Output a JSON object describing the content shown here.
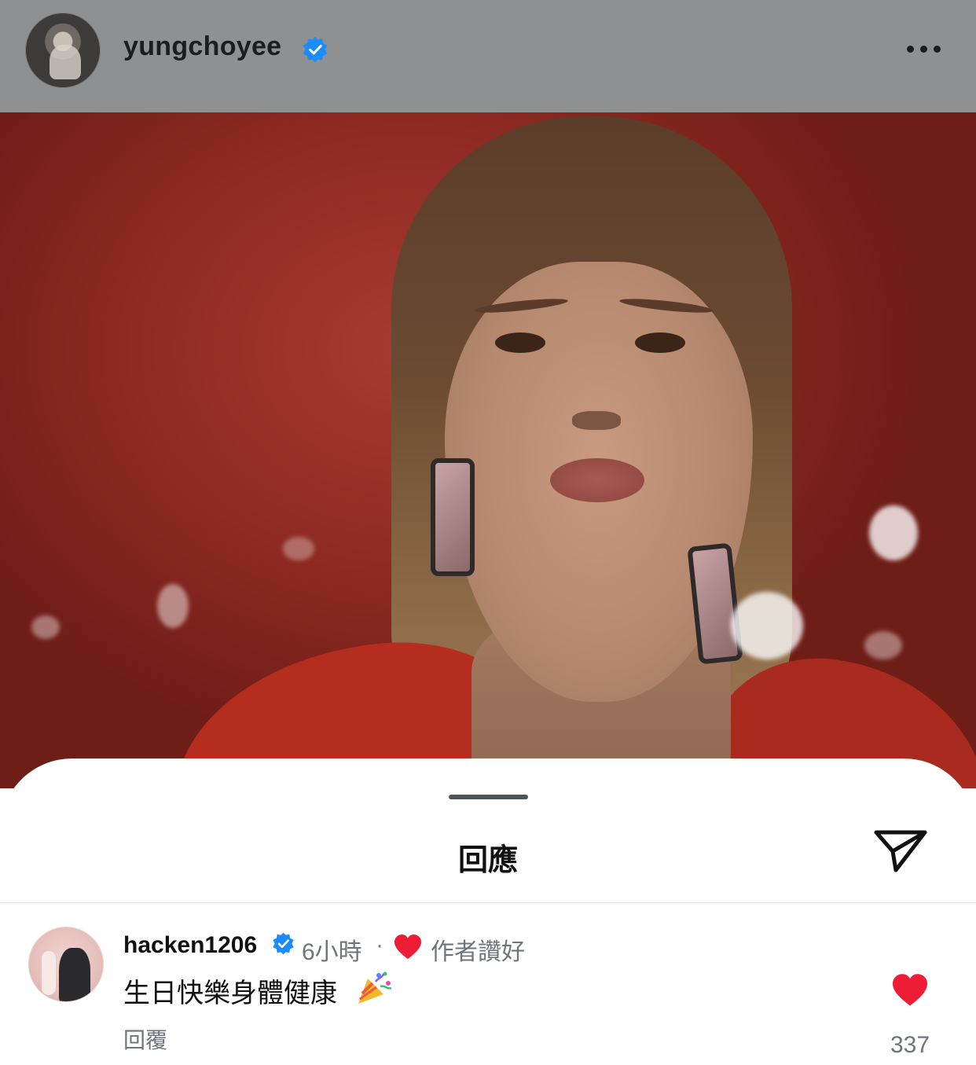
{
  "header": {
    "username": "yungchoyee",
    "verified_icon": "verified-badge-icon",
    "more_icon": "more-options-icon"
  },
  "media": {
    "kind": "video-still",
    "background_color": "#8d2a22"
  },
  "sheet": {
    "title": "回應",
    "share_icon": "send-icon"
  },
  "comment": {
    "username": "hacken1206",
    "time": "6小時",
    "separator": "·",
    "author_liked_label": "作者讚好",
    "text": "生日快樂身體健康",
    "emoji_icon": "party-popper-icon",
    "reply_label": "回覆",
    "like_count": "337",
    "heart_color": "#ee1d36"
  },
  "colors": {
    "verified": "#1a8cff",
    "secondary_text": "#6f737b",
    "header_dim": "#8f9091"
  }
}
